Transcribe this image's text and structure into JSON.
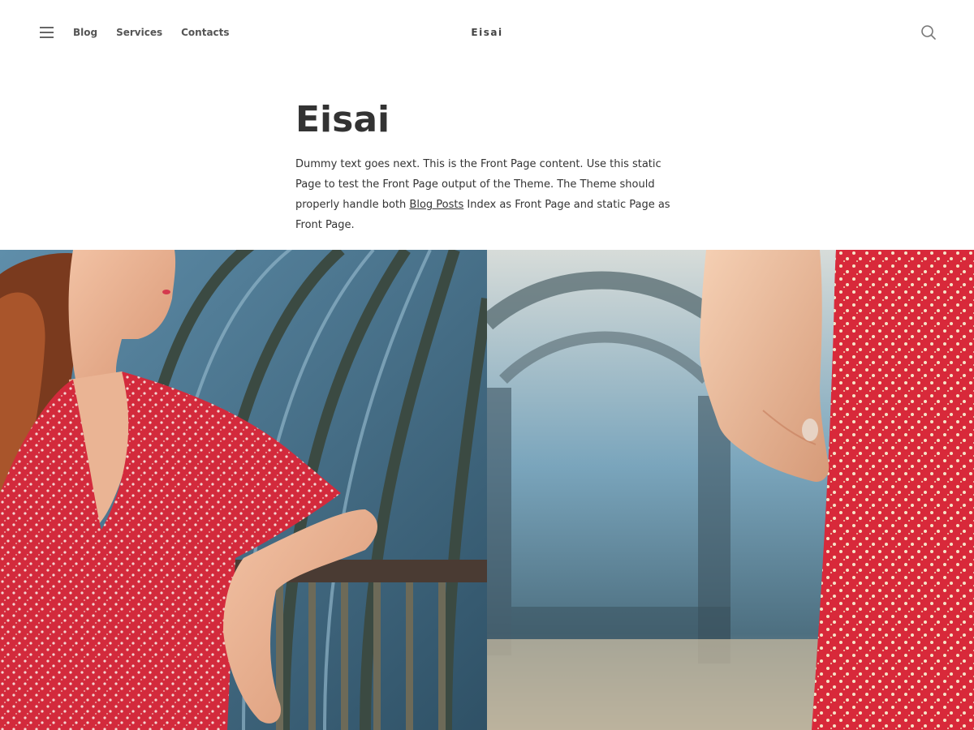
{
  "header": {
    "menu_icon": "hamburger-menu-icon",
    "nav": [
      "Blog",
      "Services",
      "Contacts"
    ],
    "site_title": "Eisai",
    "search_icon": "search-icon"
  },
  "page": {
    "title": "Eisai",
    "text_before_link": "Dummy text goes next. This is the Front Page content. Use this static Page to test the Front Page output of the Theme. The Theme should properly handle both ",
    "link_text": "Blog Posts",
    "text_after_link": " Index as Front Page and static Page as Front Page."
  },
  "gallery": {
    "images": [
      {
        "semantic": "woman-in-red-floral-dress-photo"
      },
      {
        "semantic": "hand-holding-red-floral-dress-photo"
      }
    ]
  },
  "colors": {
    "text": "#333333",
    "nav_text": "#555555",
    "dress_red": "#d8293a",
    "tunnel_blue": "#4f7d9b"
  }
}
